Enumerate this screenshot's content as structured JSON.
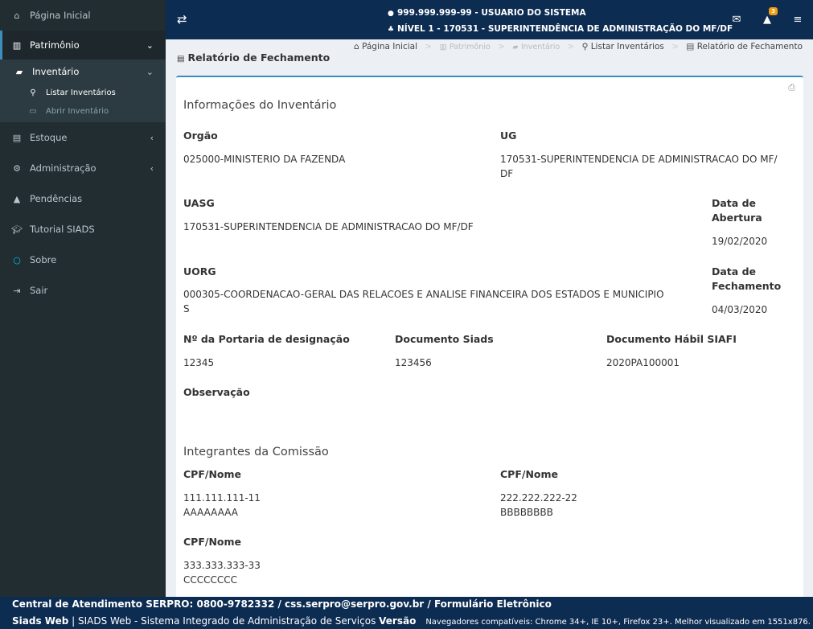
{
  "sidebar": {
    "home": "Página Inicial",
    "patrimonio": "Patrimônio",
    "inventario": "Inventário",
    "listar": "Listar Inventários",
    "abrir": "Abrir Inventário",
    "estoque": "Estoque",
    "administracao": "Administração",
    "pendencias": "Pendências",
    "tutorial": "Tutorial SIADS",
    "sobre": "Sobre",
    "sair": "Sair"
  },
  "header": {
    "user": "999.999.999-99 - USUARIO DO SISTEMA",
    "level": "NÍVEL 1 - 170531 - SUPERINTENDÊNCIA DE ADMINISTRAÇÃO DO MF/DF",
    "alert_count": "3"
  },
  "breadcrumb": {
    "home": "Página Inicial",
    "patrimonio": "Patrimônio",
    "inventario": "Inventário",
    "listar": "Listar Inventários",
    "current": "Relatório de Fechamento"
  },
  "page": {
    "title": "Relatório de Fechamento"
  },
  "info": {
    "section_title": "Informações do Inventário",
    "orgao_label": "Orgão",
    "orgao_value": "025000-MINISTERIO DA FAZENDA",
    "ug_label": "UG",
    "ug_value_1": "170531-SUPERINTENDENCIA DE ADMINISTRACAO DO MF/",
    "ug_value_2": "DF",
    "uasg_label": "UASG",
    "uasg_value": "170531-SUPERINTENDENCIA DE ADMINISTRACAO DO MF/DF",
    "abertura_label_1": "Data de",
    "abertura_label_2": "Abertura",
    "abertura_value": "19/02/2020",
    "uorg_label": "UORG",
    "uorg_value_1": "000305-COORDENACAO-GERAL DAS RELACOES E ANALISE FINANCEIRA DOS ESTADOS E MUNICIPIO",
    "uorg_value_2": "S",
    "fechamento_label_1": "Data de",
    "fechamento_label_2": "Fechamento",
    "fechamento_value": "04/03/2020",
    "portaria_label": "Nº da Portaria de designação",
    "portaria_value": "12345",
    "doc_siads_label": "Documento Siads",
    "doc_siads_value": "123456",
    "doc_siafi_label": "Documento Hábil SIAFI",
    "doc_siafi_value": "2020PA100001",
    "obs_label": "Observação"
  },
  "commission": {
    "section_title": "Integrantes da Comissão",
    "members": [
      {
        "label": "CPF/Nome",
        "cpf": "111.111.111-11",
        "name": "AAAAAAAA"
      },
      {
        "label": "CPF/Nome",
        "cpf": "222.222.222-22",
        "name": "BBBBBBBB"
      },
      {
        "label": "CPF/Nome",
        "cpf": "333.333.333-33",
        "name": "CCCCCCCC"
      }
    ]
  },
  "footer": {
    "line1": "Central de Atendimento SERPRO: 0800-9782332 / css.serpro@serpro.gov.br / Formulário Eletrônico",
    "brand": "Siads Web",
    "system": " | SIADS Web - Sistema Integrado de Administração de Serviços ",
    "version_label": "Versão",
    "browsers": "Navegadores compatíveis: Chrome 34+, IE 10+, Firefox 23+. Melhor visualizado em 1551x876."
  },
  "colors": {
    "sidebar_bg": "#222d32",
    "header_bg": "#0c2c52",
    "accent": "#3c8dbc",
    "badge": "#f39c12"
  }
}
